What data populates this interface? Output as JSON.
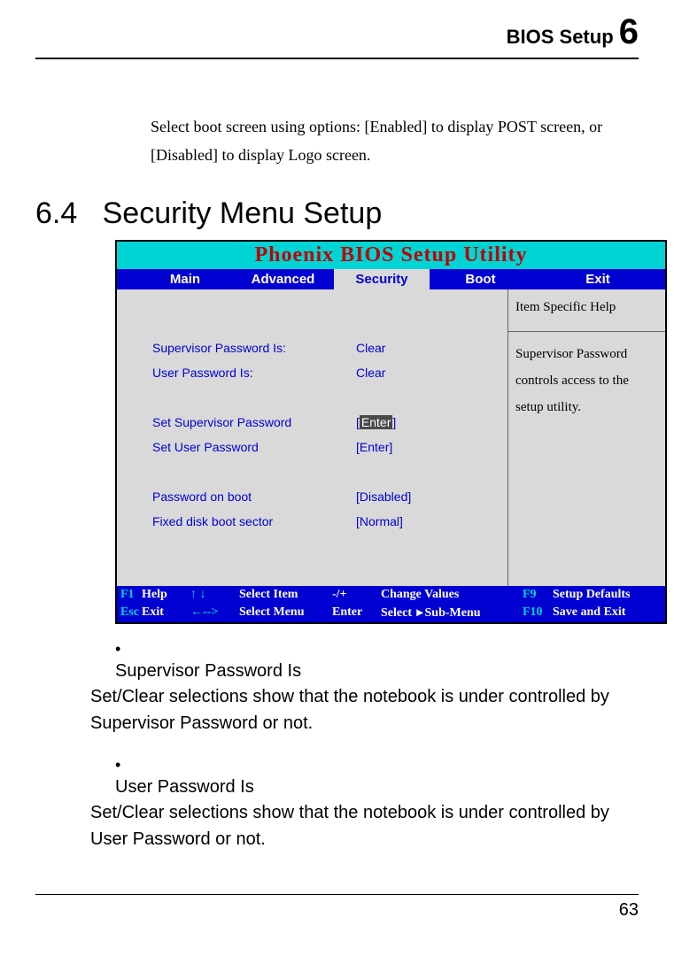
{
  "header": {
    "title": "BIOS Setup ",
    "chapter": "6"
  },
  "intro": "Select boot screen using options: [Enabled] to display POST screen, or [Disabled] to display Logo screen.",
  "section": {
    "number": "6.4",
    "title": "Security Menu Setup"
  },
  "bios": {
    "title": "Phoenix BIOS Setup Utility",
    "tabs": {
      "main": "Main",
      "advanced": "Advanced",
      "security": "Security",
      "boot": "Boot",
      "exit": "Exit"
    },
    "rows": {
      "supervisor_pw_is": {
        "label": "Supervisor Password Is:",
        "value": "Clear"
      },
      "user_pw_is": {
        "label": "User Password Is:",
        "value": "Clear"
      },
      "set_supervisor": {
        "label": "Set Supervisor Password",
        "value_prefix": "[",
        "value_inner": "Enter",
        "value_suffix": "]"
      },
      "set_user": {
        "label": "Set User Password",
        "value": "[Enter]"
      },
      "pw_boot": {
        "label": "Password on boot",
        "value": "[Disabled]"
      },
      "fixed_disk": {
        "label": "Fixed disk boot sector",
        "value": "[Normal]"
      }
    },
    "help": {
      "header": "Item Specific Help",
      "body": "Supervisor Password controls access to the setup utility."
    },
    "footer": {
      "f1": "F1",
      "help": "Help",
      "arrows_ud": "↑ ↓",
      "select_item": "Select Item",
      "pm": "-/+",
      "change_values": "Change Values",
      "f9": "F9",
      "setup_defaults": "Setup Defaults",
      "esc": "Esc",
      "exit": "Exit",
      "arrows_lr": "←-->",
      "select_menu": "Select Menu",
      "enter": "Enter",
      "select_sub": "Select ",
      "sub_menu": "Sub-Menu",
      "f10": "F10",
      "save_exit": "Save and Exit"
    }
  },
  "bullets": [
    {
      "title": "Supervisor Password Is",
      "desc": "Set/Clear selections show that the notebook is under controlled by Supervisor Password or not."
    },
    {
      "title": "User Password Is",
      "desc": "Set/Clear selections show that the notebook is under controlled by User Password or not."
    }
  ],
  "page_number": "63"
}
